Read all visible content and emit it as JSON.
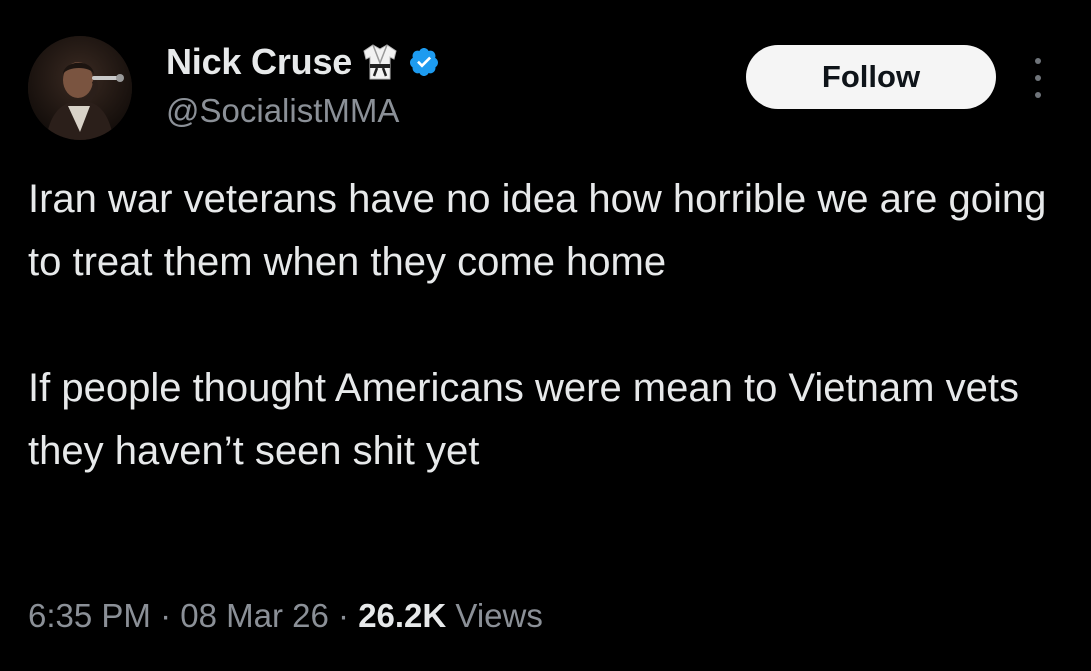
{
  "user": {
    "display_name": "Nick Cruse",
    "handle": "@SocialistMMA",
    "verified": true
  },
  "actions": {
    "follow_label": "Follow"
  },
  "tweet": {
    "paragraphs": [
      "Iran war veterans have no idea how horrible we are going to treat them when they come home",
      "If people thought Americans were mean to Vietnam vets they haven’t seen shit yet"
    ],
    "time": "6:35 PM",
    "date": "08 Mar 26",
    "separator": "·",
    "views_count": "26.2K",
    "views_label": "Views"
  },
  "icons": {
    "avatar": "profile-photo",
    "name_emoji": "martial-arts-uniform-icon",
    "verified": "verified-badge-icon",
    "more": "more-options-icon"
  },
  "colors": {
    "background": "#000000",
    "primary_text": "#e7e9ea",
    "secondary_text": "#8b9097",
    "verified_blue": "#1d9bf0",
    "follow_bg": "#f5f5f5"
  }
}
